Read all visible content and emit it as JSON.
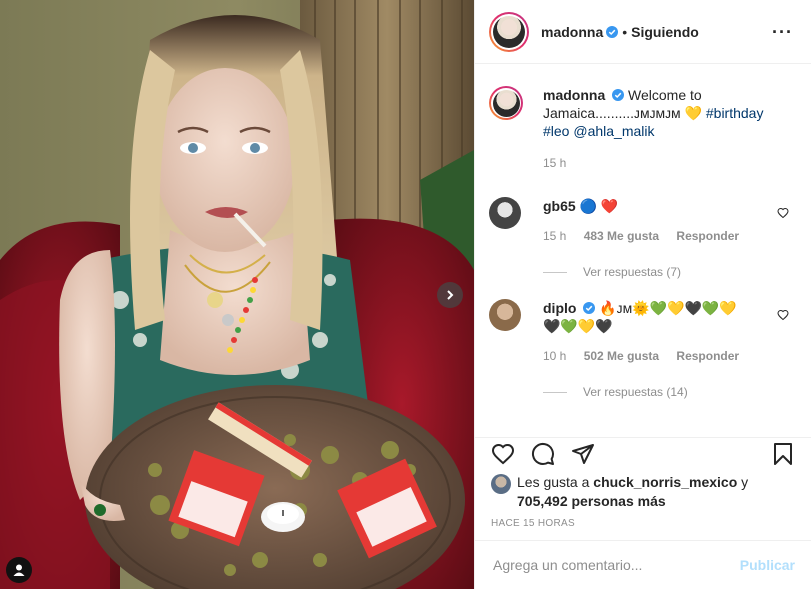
{
  "colors": {
    "accent": "#0095f6",
    "verified": "#3897f0",
    "muted": "#8e8e8e",
    "link": "#00376b",
    "heart_red": "#ed1c24"
  },
  "header": {
    "username": "madonna",
    "separator": "•",
    "follow_status": "Siguiendo",
    "more_icon": "more-horizontal-icon"
  },
  "caption": {
    "username": "madonna",
    "text": "Welcome to Jamaica..........ᴊᴍᴊᴍᴊᴍ",
    "hashtags": "#birthday #leo",
    "mention": "@ahla_malik",
    "time": "15 h"
  },
  "comments": [
    {
      "username": "gb65",
      "emojis": "🔵 ❤️",
      "time": "15 h",
      "likes": "483 Me gusta",
      "reply": "Responder",
      "view_replies": "Ver respuestas (7)"
    },
    {
      "username": "diplo",
      "emojis_line1": "🔥ᴊᴍ🌞💚💛🖤💚💛",
      "emojis_line2": "🖤💚💛🖤",
      "time": "10 h",
      "likes": "502 Me gusta",
      "reply": "Responder",
      "view_replies": "Ver respuestas (14)"
    }
  ],
  "likes": {
    "prefix": "Les gusta a",
    "user": "chuck_norris_mexico",
    "join": "y",
    "others": "705,492 personas más"
  },
  "timestamp": "HACE 15 HORAS",
  "add_comment": {
    "placeholder": "Agrega un comentario...",
    "publish": "Publicar"
  },
  "icons": {
    "like": "heart-outline-icon",
    "comment": "comment-icon",
    "share": "paper-plane-icon",
    "save": "bookmark-icon",
    "next": "chevron-right-icon",
    "tag": "user-tag-icon"
  }
}
